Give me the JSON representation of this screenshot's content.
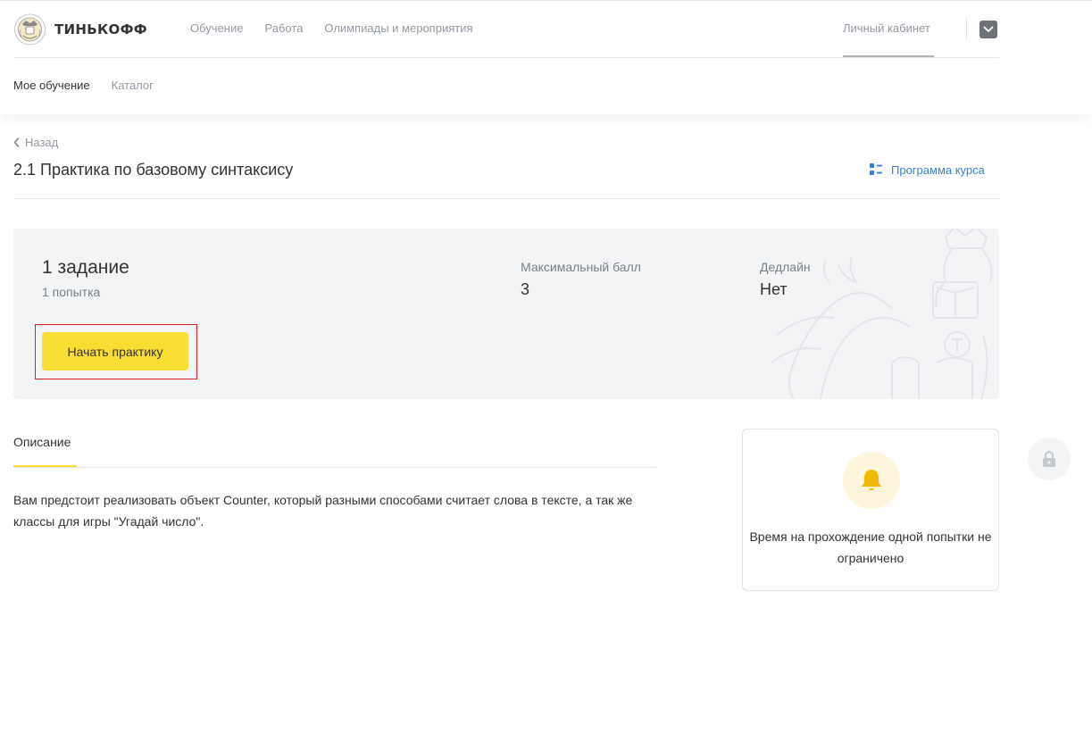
{
  "header": {
    "logo_text": "ТИНЬКОФФ",
    "nav": [
      "Обучение",
      "Работа",
      "Олимпиады и мероприятия"
    ],
    "cabinet_label": "Личный кабинет"
  },
  "subnav": {
    "my_learning": "Мое обучение",
    "catalog": "Каталог"
  },
  "page": {
    "back_label": "Назад",
    "title": "2.1 Практика по базовому синтаксису",
    "program_label": "Программа курса"
  },
  "card": {
    "task_count": "1 задание",
    "attempts": "1 попытка",
    "max_score_label": "Максимальный балл",
    "max_score_value": "3",
    "deadline_label": "Дедлайн",
    "deadline_value": "Нет",
    "start_button": "Начать практику"
  },
  "description": {
    "tab_label": "Описание",
    "text": "Вам предстоит реализовать объект Counter, который разными способами считает слова в тексте, а так же классы для игры \"Угадай число\"."
  },
  "timer": {
    "text": "Время на прохождение одной попытки не ограничено"
  },
  "colors": {
    "accent_yellow": "#f8dd32",
    "link_blue": "#3b7dd8",
    "muted_text": "#9299a2",
    "card_bg": "#f3f4f6",
    "highlight_frame": "#e02020"
  },
  "icons": [
    "tinkoff-logo-icon",
    "chevron-down-icon",
    "chevron-left-icon",
    "program-list-icon",
    "bell-icon",
    "lock-icon"
  ]
}
